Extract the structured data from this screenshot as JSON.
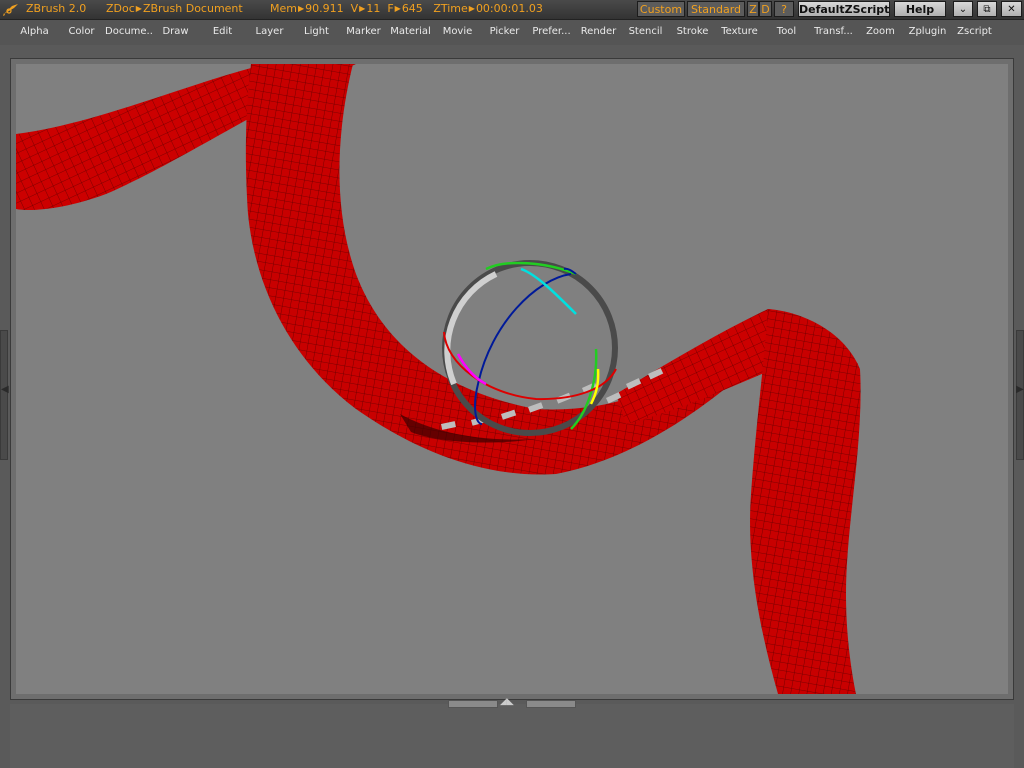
{
  "titlebar": {
    "app": "ZBrush 2.0",
    "doc_label": "ZDoc",
    "doc_name": "ZBrush Document",
    "mem_label": "Mem",
    "mem_value": "90.911",
    "v_label": "V",
    "v_value": "11",
    "f_label": "F",
    "f_value": "645",
    "ztime_label": "ZTime",
    "ztime_value": "00:00:01.03",
    "custom_label": "Custom",
    "standard_label": "Standard",
    "z_label": "Z",
    "d_label": "D",
    "help_q_label": "?",
    "script_label": "DefaultZScript",
    "help_label": "Help",
    "win_min": "⌄",
    "win_restore": "⧉",
    "win_close": "✕"
  },
  "menu": [
    "Alpha",
    "Color",
    "Docume...",
    "Draw",
    "Edit",
    "Layer",
    "Light",
    "Marker",
    "Material",
    "Movie",
    "Picker",
    "Prefer...",
    "Render",
    "Stencil",
    "Stroke",
    "Texture",
    "Tool",
    "Transf...",
    "Zoom",
    "Zplugin",
    "Zscript"
  ],
  "colors": {
    "accent": "#f0a020",
    "ribbon": "#cc0000",
    "canvas_bg": "#808080",
    "ui_bg": "#555555"
  },
  "icons": {
    "logo": "zbrush-logo-icon",
    "left_panel": "expand-left-arrow-icon",
    "right_panel": "expand-right-arrow-icon",
    "tray": "tray-toggle-arrows-icon"
  }
}
